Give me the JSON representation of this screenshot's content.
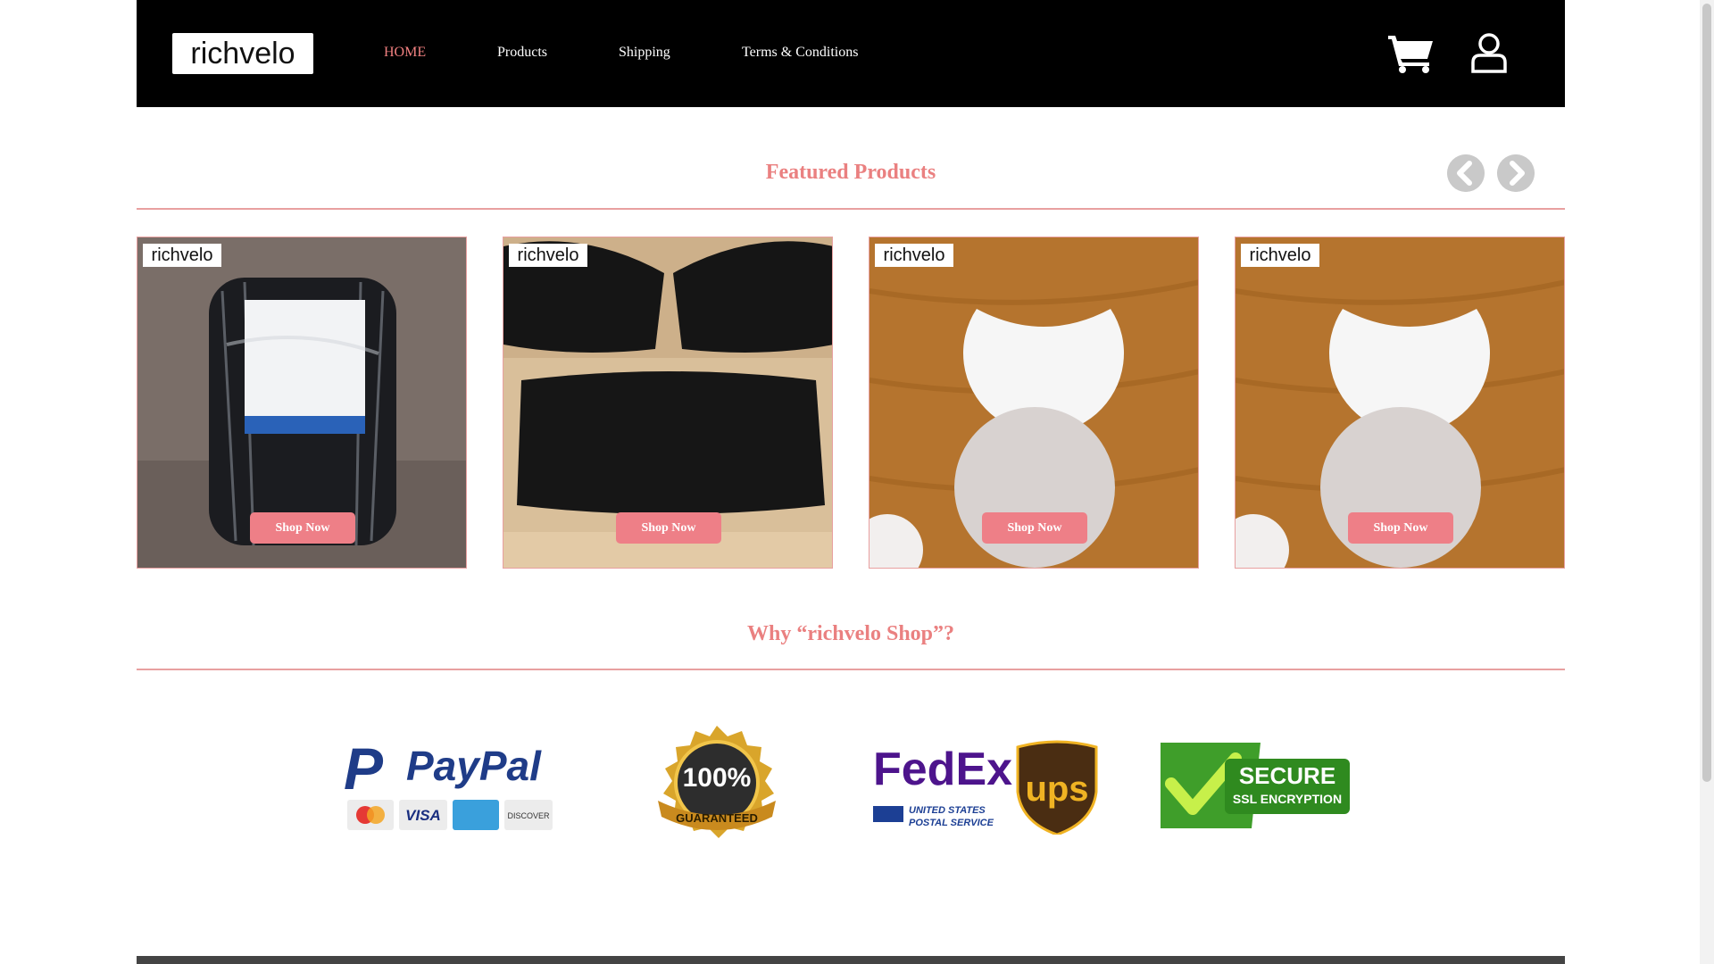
{
  "header": {
    "logo_text": "richvelo",
    "nav": [
      {
        "label": "HOME",
        "active": true
      },
      {
        "label": "Products",
        "active": false
      },
      {
        "label": "Shipping",
        "active": false
      },
      {
        "label": "Terms & Conditions",
        "active": false
      }
    ],
    "icons": {
      "cart": "cart-icon",
      "user": "user-icon"
    }
  },
  "featured": {
    "title": "Featured Products",
    "icons": {
      "prev": "chevron-left-icon",
      "next": "chevron-right-icon"
    },
    "products": [
      {
        "brand": "richvelo",
        "button": "Shop Now",
        "image": "wrapped tire"
      },
      {
        "brand": "richvelo",
        "button": "Shop Now",
        "image": "black car seat cushions"
      },
      {
        "brand": "richvelo",
        "button": "Shop Now",
        "image": "white coasters on wood"
      },
      {
        "brand": "richvelo",
        "button": "Shop Now",
        "image": "white coasters on wood"
      }
    ]
  },
  "why": {
    "title": "Why “richvelo Shop”?",
    "badges": {
      "paypal": {
        "name": "PayPal",
        "cards": [
          "MasterCard",
          "VISA",
          "AMERICAN EXPRESS",
          "DISCOVER"
        ]
      },
      "guarantee": {
        "line1": "100%",
        "line2": "GUARANTEED"
      },
      "shipping": {
        "fedex": "FedEx",
        "usps_line1": "UNITED STATES",
        "usps_line2": "POSTAL SERVICE",
        "ups": "ups"
      },
      "secure": {
        "line1": "SECURE",
        "line2": "SSL ENCRYPTION"
      }
    }
  },
  "colors": {
    "accent": "#ea8080",
    "button": "#ee7f87",
    "header_bg": "#000000"
  }
}
